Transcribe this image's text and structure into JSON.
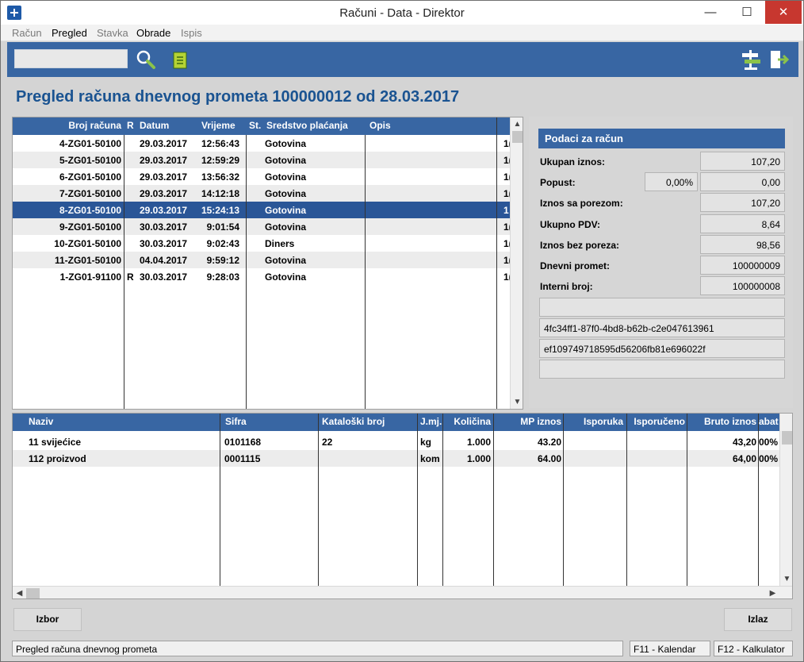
{
  "window": {
    "title": "Računi - Data - Direktor",
    "min": "—",
    "max": "☐",
    "close": "✕"
  },
  "menu": [
    "Račun",
    "Pregled",
    "Stavka",
    "Obrade",
    "Ispis"
  ],
  "toolbar": {
    "search_value": ""
  },
  "page_title": "Pregled računa dnevnog prometa 100000012 od 28.03.2017",
  "invoices": {
    "headers": [
      "Broj računa",
      "R",
      "Datum",
      "Vrijeme",
      "St.",
      "Sredstvo plaćanja",
      "Opis"
    ],
    "rows": [
      {
        "broj": "4-ZG01-50100",
        "r": "",
        "datum": "29.03.2017",
        "vrijeme": "12:56:43",
        "st": "",
        "sredstvo": "Gotovina",
        "opis": "",
        "extra": "1("
      },
      {
        "broj": "5-ZG01-50100",
        "r": "",
        "datum": "29.03.2017",
        "vrijeme": "12:59:29",
        "st": "",
        "sredstvo": "Gotovina",
        "opis": "",
        "extra": "1("
      },
      {
        "broj": "6-ZG01-50100",
        "r": "",
        "datum": "29.03.2017",
        "vrijeme": "13:56:32",
        "st": "",
        "sredstvo": "Gotovina",
        "opis": "",
        "extra": "1("
      },
      {
        "broj": "7-ZG01-50100",
        "r": "",
        "datum": "29.03.2017",
        "vrijeme": "14:12:18",
        "st": "",
        "sredstvo": "Gotovina",
        "opis": "",
        "extra": "1("
      },
      {
        "broj": "8-ZG01-50100",
        "r": "",
        "datum": "29.03.2017",
        "vrijeme": "15:24:13",
        "st": "",
        "sredstvo": "Gotovina",
        "opis": "",
        "extra": "1"
      },
      {
        "broj": "9-ZG01-50100",
        "r": "",
        "datum": "30.03.2017",
        "vrijeme": "9:01:54",
        "st": "",
        "sredstvo": "Gotovina",
        "opis": "",
        "extra": "1("
      },
      {
        "broj": "10-ZG01-50100",
        "r": "",
        "datum": "30.03.2017",
        "vrijeme": "9:02:43",
        "st": "",
        "sredstvo": "Diners",
        "opis": "",
        "extra": "1("
      },
      {
        "broj": "11-ZG01-50100",
        "r": "",
        "datum": "04.04.2017",
        "vrijeme": "9:59:12",
        "st": "",
        "sredstvo": "Gotovina",
        "opis": "",
        "extra": "1("
      },
      {
        "broj": "1-ZG01-91100",
        "r": "R",
        "datum": "30.03.2017",
        "vrijeme": "9:28:03",
        "st": "",
        "sredstvo": "Gotovina",
        "opis": "",
        "extra": "1("
      }
    ],
    "selected_index": 4
  },
  "details": {
    "title": "Podaci za račun",
    "ukupan_iznos_label": "Ukupan iznos:",
    "ukupan_iznos": "107,20",
    "popust_label": "Popust:",
    "popust_pct": "0,00%",
    "popust": "0,00",
    "iznos_sa_porezom_label": "Iznos sa porezom:",
    "iznos_sa_porezom": "107,20",
    "ukupno_pdv_label": "Ukupno PDV:",
    "ukupno_pdv": "8,64",
    "iznos_bez_poreza_label": "Iznos bez poreza:",
    "iznos_bez_poreza": "98,56",
    "dnevni_promet_label": "Dnevni promet:",
    "dnevni_promet": "100000009",
    "interni_broj_label": "Interni broj:",
    "interni_broj": "100000008",
    "box1": "",
    "box2": "4fc34ff1-87f0-4bd8-b62b-c2e047613961",
    "box3": "ef109749718595d56206fb81e696022f",
    "box4": ""
  },
  "items": {
    "headers": [
      "Naziv",
      "Sifra",
      "Kataloški broj",
      "J.mj.",
      "Količina",
      "MP iznos",
      "Isporuka",
      "Isporučeno",
      "Bruto iznos",
      "abat"
    ],
    "rows": [
      {
        "naziv": "11 svijećice",
        "sifra": "0101168",
        "katalog": "22",
        "jmj": "kg",
        "kolicina": "1.000",
        "mp": "43.20",
        "isporuka": "",
        "isporuceno": "",
        "bruto": "43,20",
        "rabat": "00%"
      },
      {
        "naziv": "112 proizvod",
        "sifra": "0001115",
        "katalog": "",
        "jmj": "kom",
        "kolicina": "1.000",
        "mp": "64.00",
        "isporuka": "",
        "isporuceno": "",
        "bruto": "64,00",
        "rabat": "00%"
      }
    ]
  },
  "buttons": {
    "izbor": "Izbor",
    "izlaz": "Izlaz"
  },
  "status": {
    "text": "Pregled računa dnevnog prometa",
    "f11": "F11 - Kalendar",
    "f12": "F12 - Kalkulator"
  }
}
